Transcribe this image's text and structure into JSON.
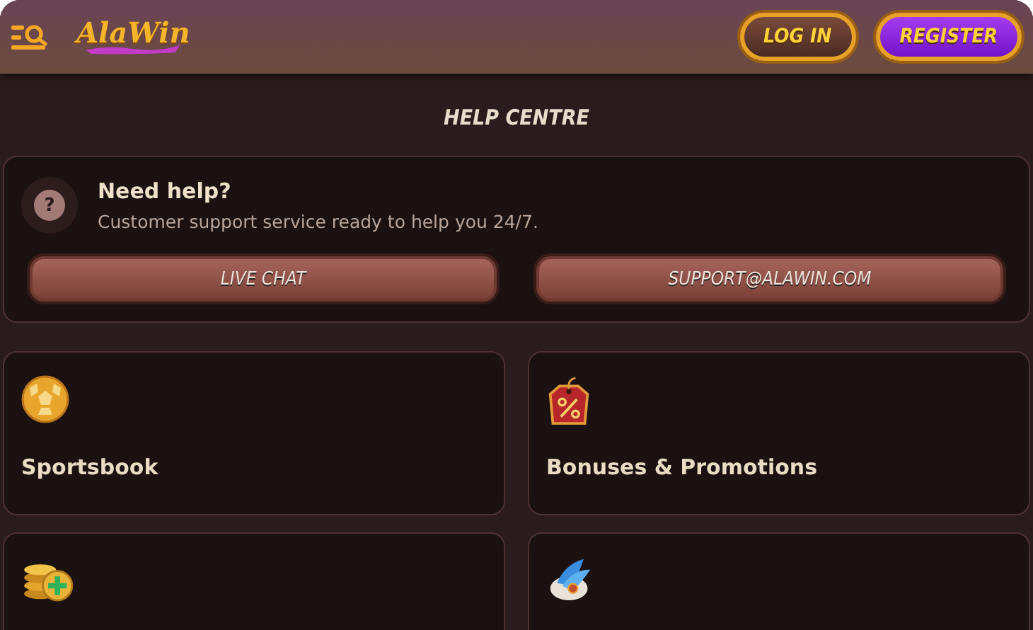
{
  "header": {
    "logo": "AlaWin",
    "buttons": [
      {
        "label": "LOG IN",
        "kind": "login"
      },
      {
        "label": "REGISTER",
        "kind": "register"
      }
    ]
  },
  "page_title": "HELP CENTRE",
  "help": {
    "title": "Need help?",
    "icon": "?",
    "text": "Customer support service ready to help you 24/7.",
    "buttons": [
      "LIVE CHAT",
      "SUPPORT@ALAWIN.COM"
    ]
  },
  "cards": [
    {
      "kind": "category",
      "title": "Sportsbook"
    },
    {
      "kind": "category",
      "title": "Bonuses & Promotions"
    },
    {
      "kind": "category"
    },
    {
      "kind": "category"
    }
  ]
}
